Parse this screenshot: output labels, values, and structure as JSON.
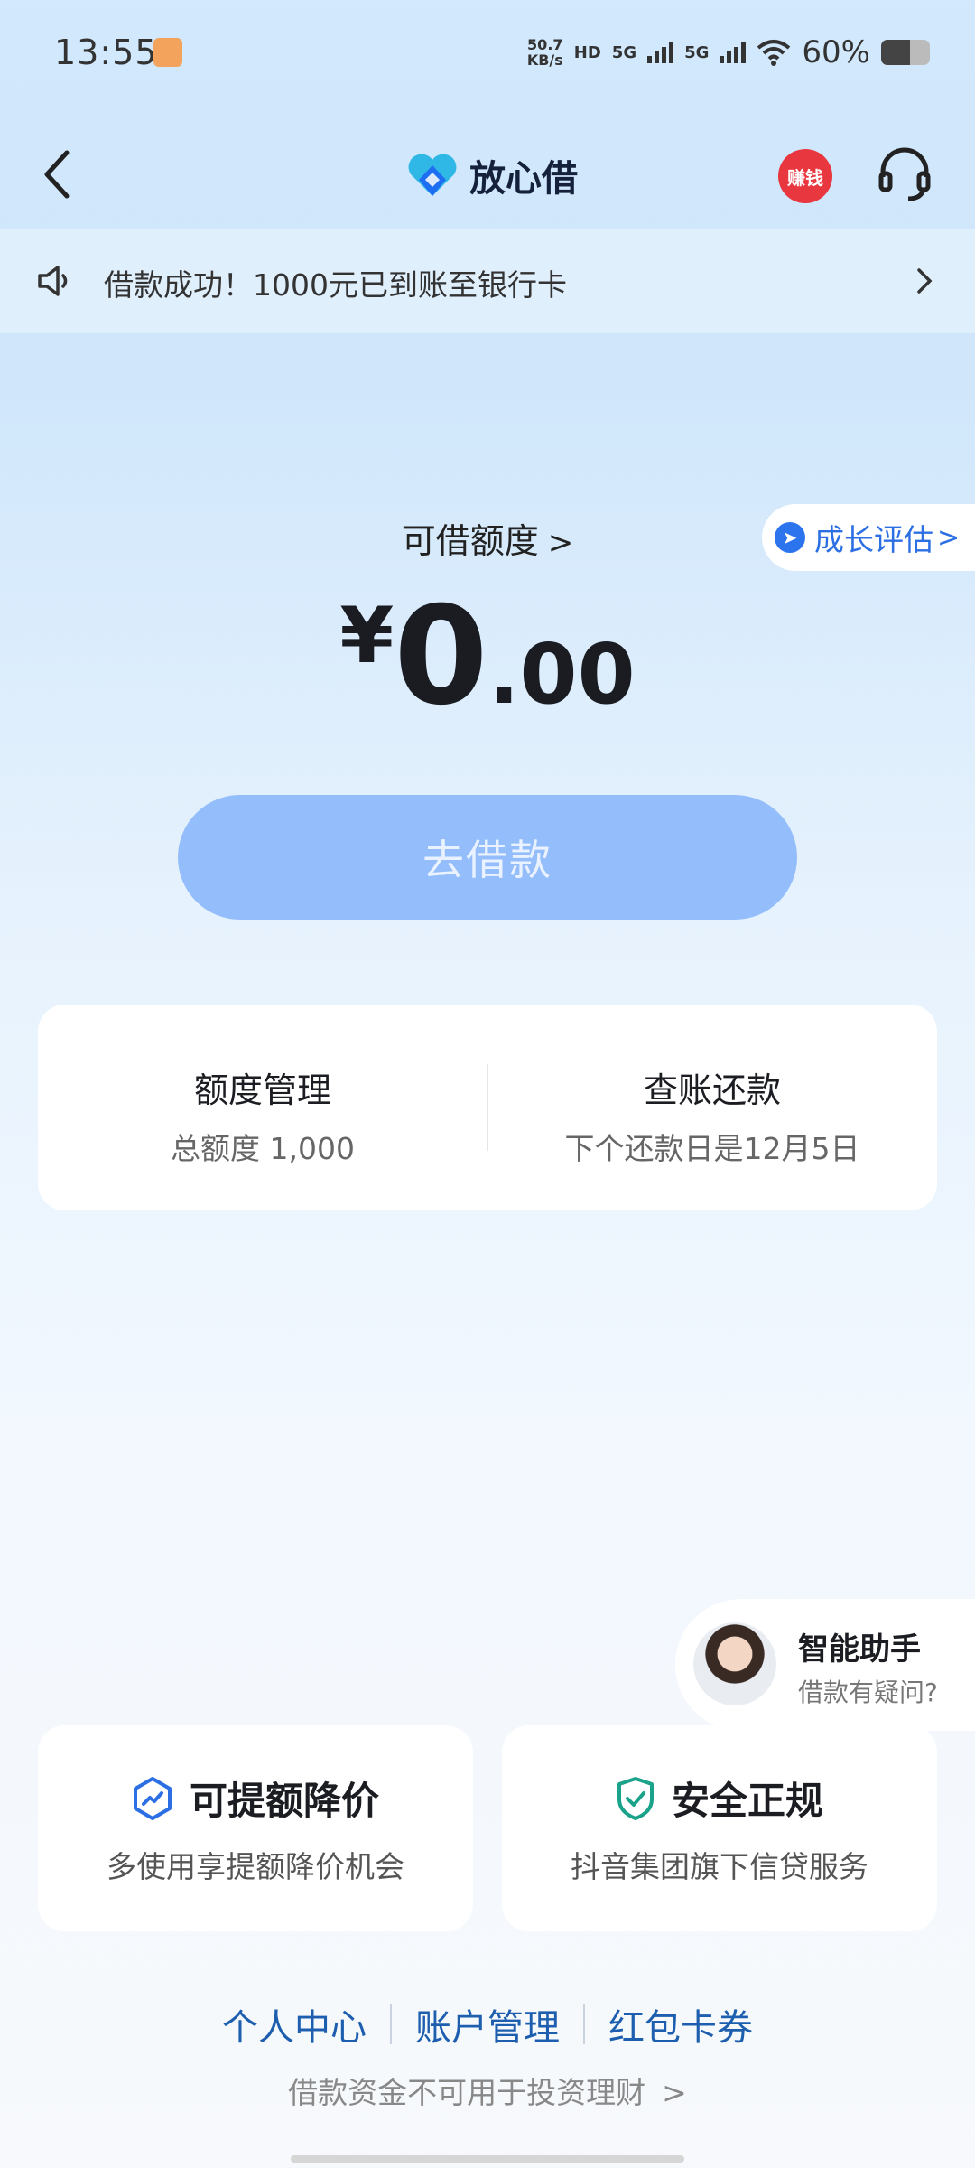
{
  "status_bar": {
    "time": "13:55",
    "net_speed_value": "50.7",
    "net_speed_unit": "KB/s",
    "hd_tag": "HD",
    "sim1_tag": "5G",
    "sim2_tag": "5G",
    "battery_percent": "60%",
    "battery_level": 0.6
  },
  "nav": {
    "title": "放心借",
    "earn_label": "赚钱"
  },
  "notice": {
    "text": "借款成功！1000元已到账至银行卡"
  },
  "limit": {
    "label": "可借额度",
    "chevron": ">",
    "currency": "¥",
    "integer": "0",
    "decimal": ".00"
  },
  "growth": {
    "label": "成长评估",
    "chevron": ">"
  },
  "borrow_button": "去借款",
  "manage": {
    "left_title": "额度管理",
    "left_sub": "总额度 1,000",
    "right_title": "查账还款",
    "right_sub": "下个还款日是12月5日"
  },
  "assistant": {
    "title": "智能助手",
    "subtitle": "借款有疑问?"
  },
  "features": [
    {
      "title": "可提额降价",
      "desc": "多使用享提额降价机会"
    },
    {
      "title": "安全正规",
      "desc": "抖音集团旗下信贷服务"
    }
  ],
  "links": [
    "个人中心",
    "账户管理",
    "红包卡券"
  ],
  "disclaimer": "借款资金不可用于投资理财",
  "colors": {
    "primary_blue": "#2c6fe4",
    "button_blue": "#93bdfb",
    "earn_red": "#e8373f",
    "shield_green": "#1aa38a"
  }
}
